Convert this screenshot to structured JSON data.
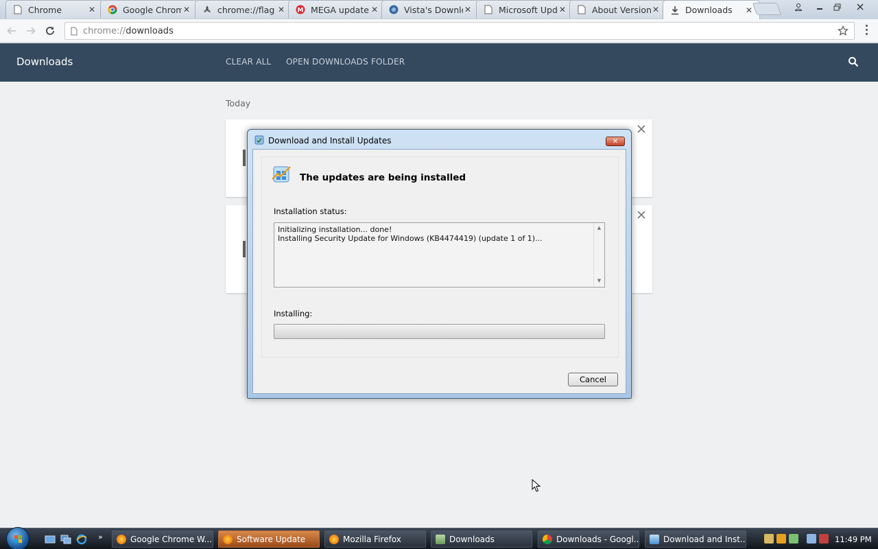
{
  "browser": {
    "tabs": [
      {
        "label": "Chrome",
        "icon": "document-icon"
      },
      {
        "label": "Google Chrom",
        "icon": "chrome-icon"
      },
      {
        "label": "chrome://flag",
        "icon": "flags-icon"
      },
      {
        "label": "MEGA update",
        "icon": "mega-icon"
      },
      {
        "label": "Vista's Downlo",
        "icon": "site-icon"
      },
      {
        "label": "Microsoft Upd",
        "icon": "document-icon"
      },
      {
        "label": "About Version",
        "icon": "document-icon"
      },
      {
        "label": "Downloads",
        "icon": "download-icon",
        "active": true
      }
    ],
    "url_scheme": "chrome://",
    "url_host": "downloads"
  },
  "downloads_page": {
    "title": "Downloads",
    "clear_all": "CLEAR ALL",
    "open_folder": "OPEN DOWNLOADS FOLDER",
    "section_today": "Today",
    "header_color": "#34495e"
  },
  "dialog": {
    "title": "Download and Install Updates",
    "heading": "The updates are being installed",
    "status_label": "Installation status:",
    "status_lines": [
      "Initializing installation... done!",
      "Installing Security Update for Windows (KB4474419) (update 1 of 1)..."
    ],
    "installing_label": "Installing:",
    "progress_fraction": 0.0,
    "cancel_label": "Cancel"
  },
  "taskbar": {
    "buttons": [
      {
        "label": "Google Chrome W...",
        "icon": "firefox-icon"
      },
      {
        "label": "Software Update",
        "icon": "firefox-icon",
        "active": true
      },
      {
        "label": "Mozilla Firefox",
        "icon": "firefox-icon"
      },
      {
        "label": "Downloads",
        "icon": "folder-icon"
      },
      {
        "label": "Downloads - Googl...",
        "icon": "chrome-icon"
      },
      {
        "label": "Download and Inst...",
        "icon": "windows-update-icon"
      }
    ],
    "clock": "11:49 PM"
  }
}
